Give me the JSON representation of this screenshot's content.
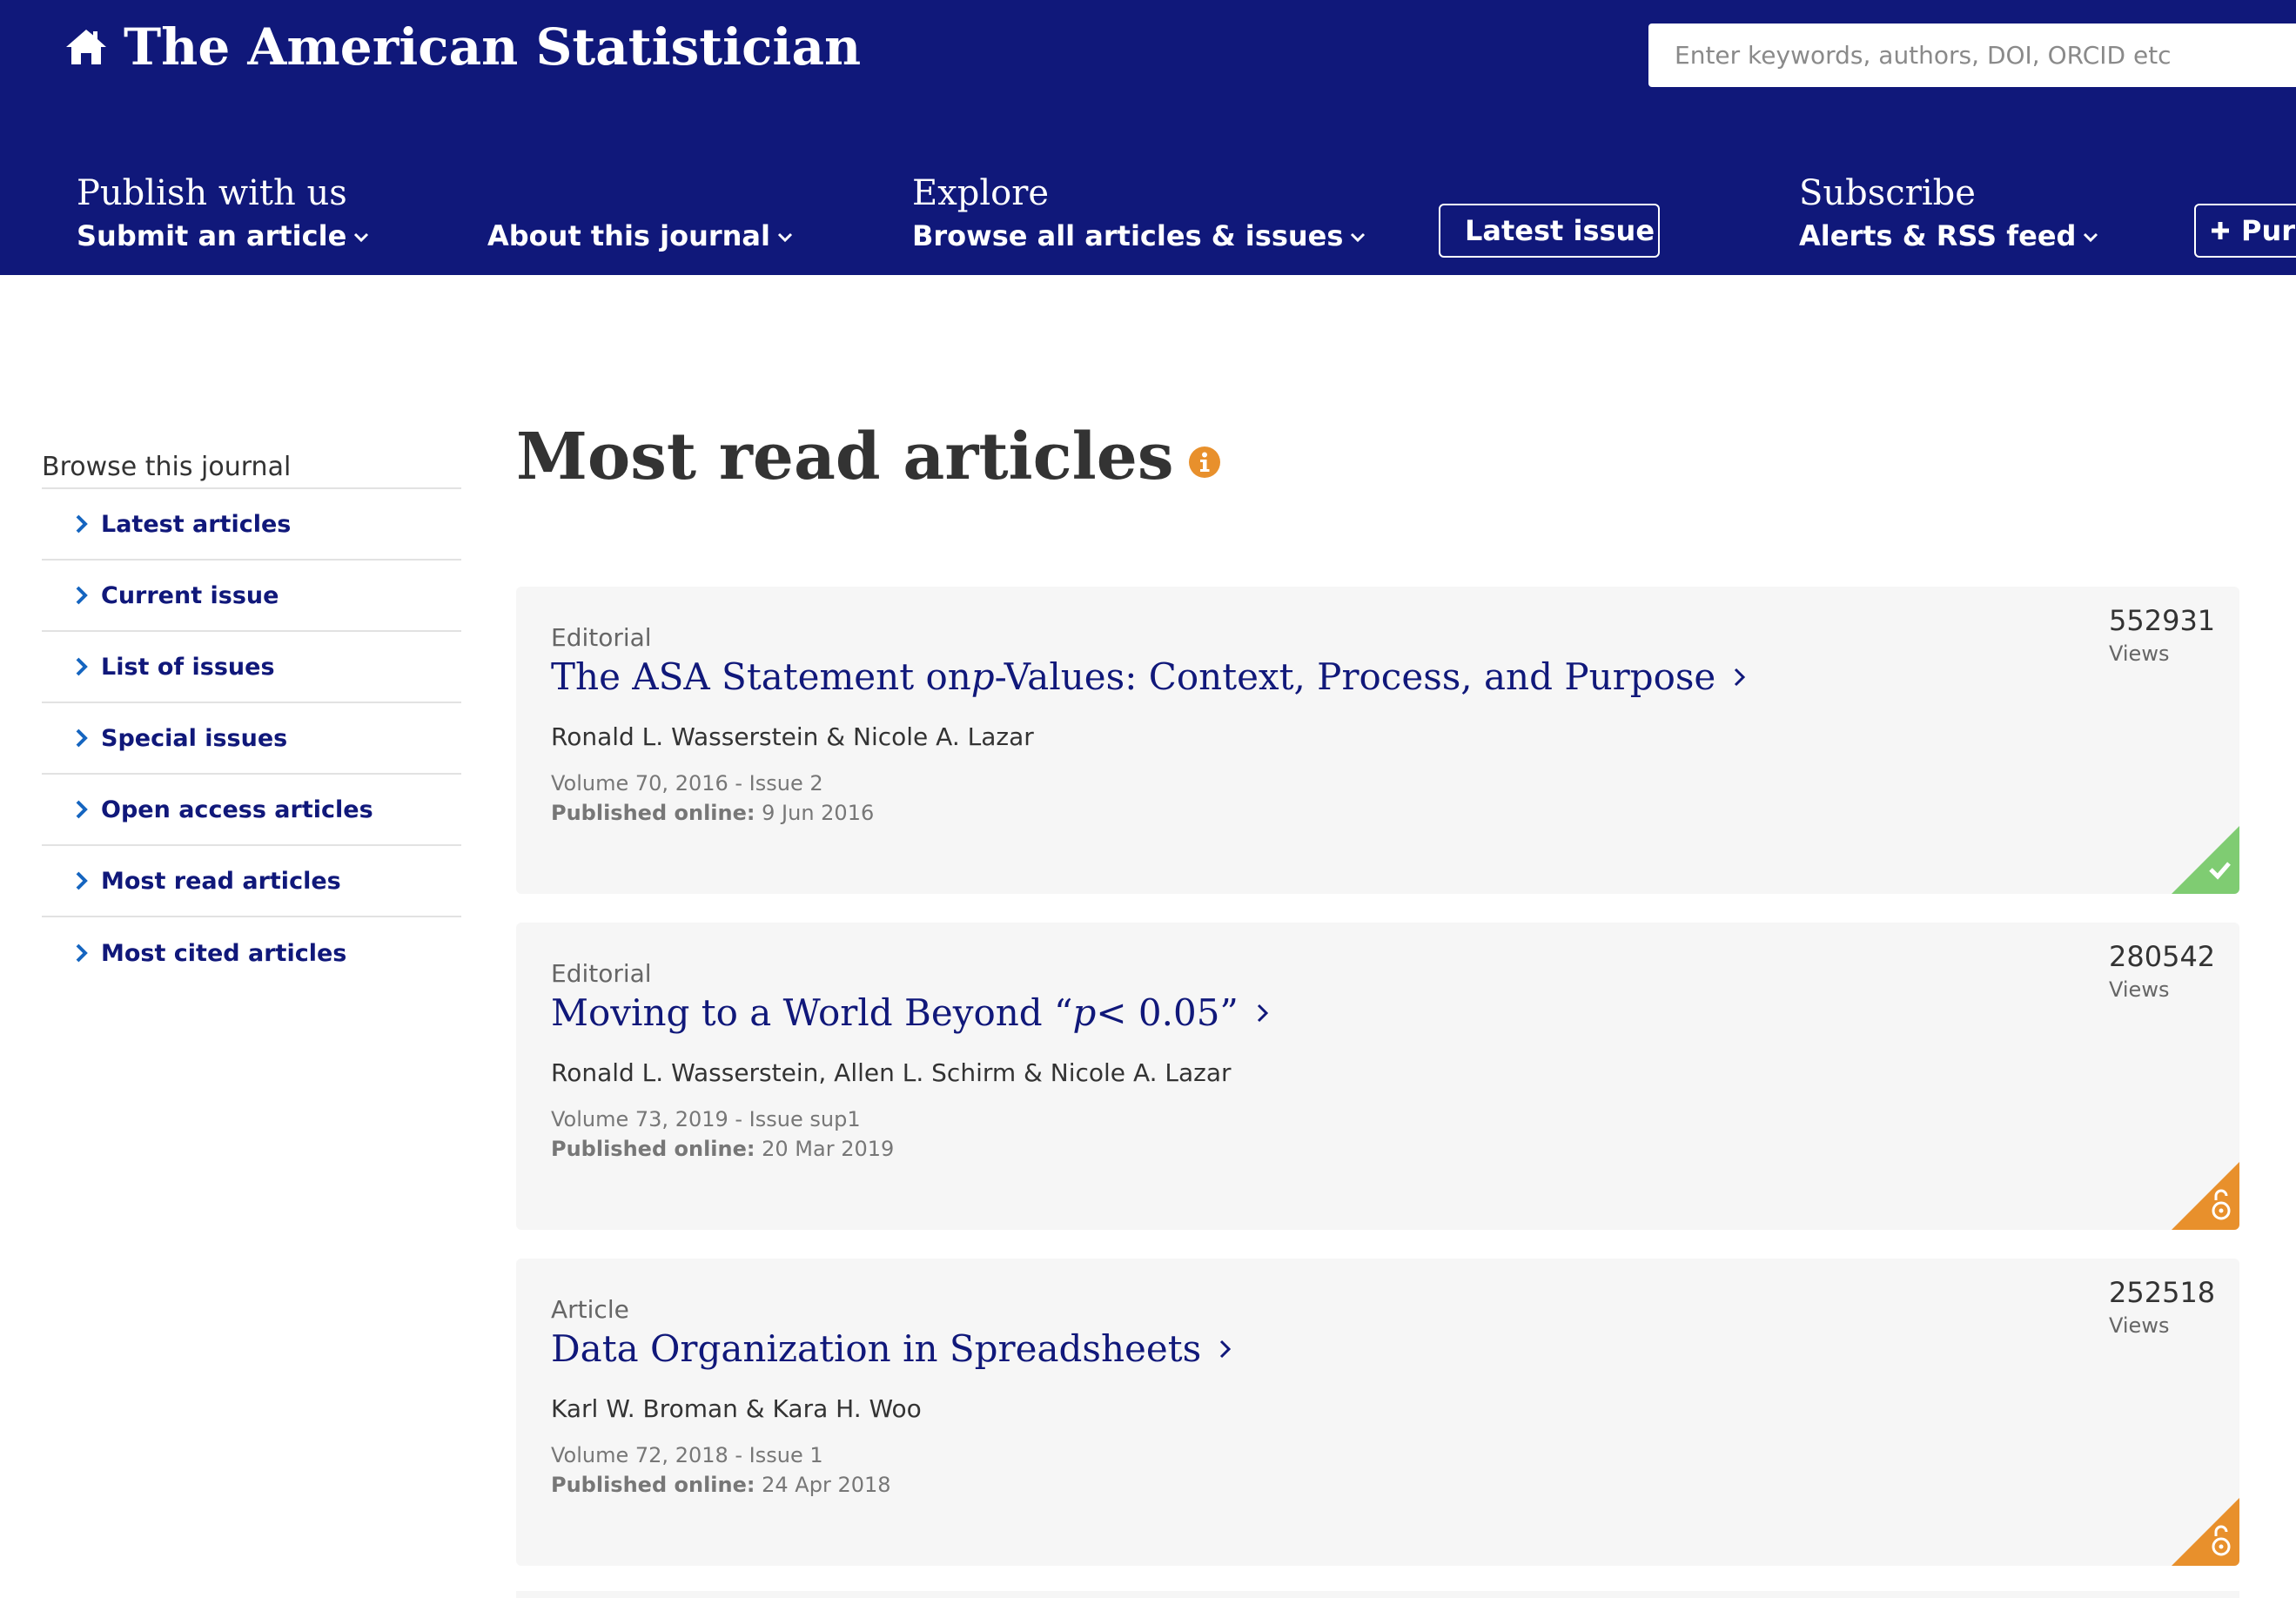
{
  "header": {
    "site_title": "The American Statistician",
    "search_placeholder": "Enter keywords, authors, DOI, ORCID etc"
  },
  "nav": {
    "publish": {
      "heading": "Publish with us",
      "link": "Submit an article"
    },
    "about": {
      "link": "About this journal"
    },
    "explore": {
      "heading": "Explore",
      "link": "Browse all articles & issues"
    },
    "latest_issue": "Latest issue",
    "subscribe": {
      "heading": "Subscribe",
      "link": "Alerts & RSS feed"
    },
    "purchase": "Purc"
  },
  "sidebar": {
    "title": "Browse this journal",
    "items": [
      {
        "label": "Latest articles"
      },
      {
        "label": "Current issue"
      },
      {
        "label": "List of issues"
      },
      {
        "label": "Special issues"
      },
      {
        "label": "Open access articles"
      },
      {
        "label": "Most read articles"
      },
      {
        "label": "Most cited articles"
      }
    ]
  },
  "main": {
    "title": "Most read articles",
    "published_label": "Published online:",
    "views_label": "Views",
    "articles": [
      {
        "type": "Editorial",
        "title_before": "The ASA Statement on ",
        "title_italic": "p",
        "title_after": "-Values: Context, Process, and Purpose",
        "authors": "Ronald L. Wasserstein & Nicole A. Lazar",
        "volume": "Volume 70, 2016 - Issue 2",
        "published": "9 Jun 2016",
        "views": "552931",
        "access": "free-access",
        "access_color": "#7fcc72"
      },
      {
        "type": "Editorial",
        "title_before": "Moving to a World Beyond “",
        "title_italic": "p",
        "title_after": " < 0.05”",
        "authors": "Ronald L. Wasserstein, Allen L. Schirm & Nicole A. Lazar",
        "volume": "Volume 73, 2019 - Issue sup1",
        "published": "20 Mar 2019",
        "views": "280542",
        "access": "open-access",
        "access_color": "#e8902c"
      },
      {
        "type": "Article",
        "title_before": "Data Organization in Spreadsheets",
        "title_italic": "",
        "title_after": "",
        "authors": "Karl W. Broman & Kara H. Woo",
        "volume": "Volume 72, 2018 - Issue 1",
        "published": "24 Apr 2018",
        "views": "252518",
        "access": "open-access",
        "access_color": "#e8902c"
      }
    ]
  },
  "colors": {
    "header_bg": "#10187a",
    "link": "#10187a",
    "info_icon": "#e8902c",
    "card_bg": "#f6f6f6"
  }
}
